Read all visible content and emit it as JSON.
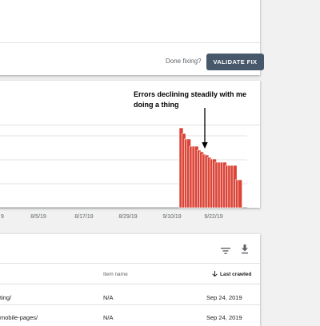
{
  "top_card": {
    "done_fixing_label": "Done fixing?",
    "validate_button_label": "VALIDATE FIX"
  },
  "annotation": {
    "text": "Errors declining steadily with me doing a thing"
  },
  "chart_data": {
    "type": "bar",
    "title": "",
    "xlabel": "",
    "ylabel": "",
    "x_tick_labels": [
      "9",
      "8/5/19",
      "8/17/19",
      "8/29/19",
      "9/10/19",
      "9/22/19"
    ],
    "bar_color": "#db4437",
    "values": [
      100,
      93,
      86,
      86,
      77,
      77,
      77,
      72,
      70,
      67,
      66,
      63,
      61,
      61,
      57,
      57,
      57,
      57,
      53,
      53,
      53,
      53,
      35,
      35
    ],
    "ylim": [
      0,
      120
    ],
    "grid": true
  },
  "table": {
    "headers": {
      "item_name": "Item name",
      "last_crawled": "Last crawled"
    },
    "rows": [
      {
        "url": "ting/",
        "item_name": "N/A",
        "last_crawled": "Sep 24, 2019"
      },
      {
        "url": "mobile-pages/",
        "item_name": "N/A",
        "last_crawled": "Sep 24, 2019"
      }
    ]
  },
  "icons": {
    "filter": "filter-icon",
    "download": "download-icon",
    "sort": "arrow-down-icon"
  }
}
